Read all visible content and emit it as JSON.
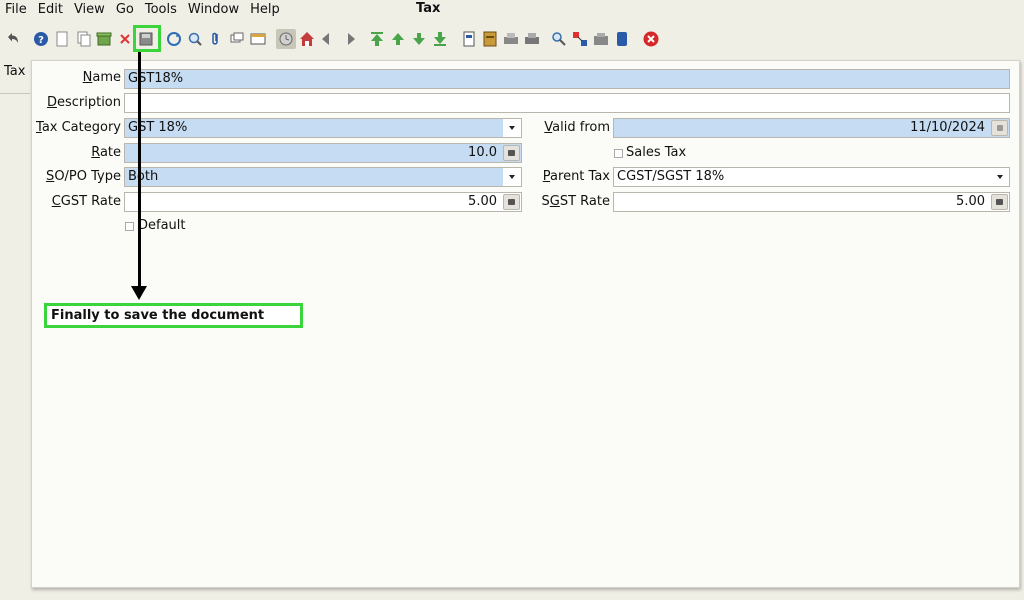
{
  "menu": {
    "items": [
      {
        "label": "File"
      },
      {
        "label": "Edit"
      },
      {
        "label": "View"
      },
      {
        "label": "Go"
      },
      {
        "label": "Tools"
      },
      {
        "label": "Window"
      },
      {
        "label": "Help"
      }
    ]
  },
  "window": {
    "title": "Tax"
  },
  "side_tab": {
    "label": "Tax"
  },
  "form": {
    "name": {
      "label": "Name",
      "value": "GST18%"
    },
    "description": {
      "label": "Description",
      "value": ""
    },
    "tax_category": {
      "label": "Tax Category",
      "value": "GST 18%"
    },
    "valid_from": {
      "label": "Valid from",
      "value": "11/10/2024"
    },
    "rate": {
      "label": "Rate",
      "value": "10.0"
    },
    "sales_tax": {
      "label": "Sales Tax",
      "checked": false
    },
    "so_po_type": {
      "label": "SO/PO Type",
      "value": "Both"
    },
    "parent_tax": {
      "label": "Parent Tax",
      "value": "CGST/SGST 18%"
    },
    "cgst_rate": {
      "label": "CGST Rate",
      "value": "5.00"
    },
    "sgst_rate": {
      "label": "SGST Rate",
      "value": "5.00"
    },
    "default": {
      "label": "Default",
      "checked": false
    }
  },
  "annotation": {
    "text": "Finally to save the document",
    "color": "#3cd43c"
  },
  "colors": {
    "mandatory_field": "#c6dcf2",
    "highlight": "#3cd43c"
  }
}
